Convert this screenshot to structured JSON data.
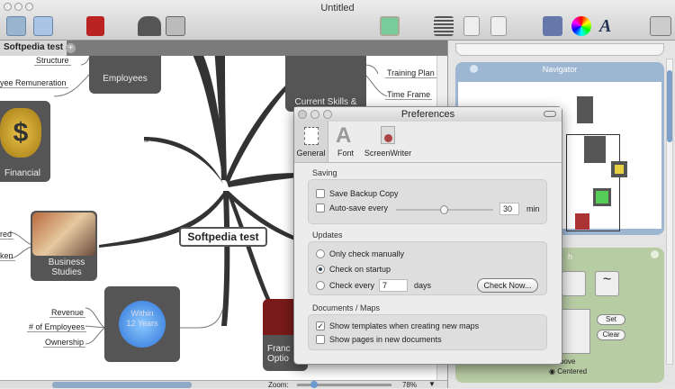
{
  "window": {
    "title": "Untitled"
  },
  "toolbar": {
    "icons": [
      "layout-icon",
      "layout-alt-icon",
      "book-icon",
      "people-icon",
      "contacts-icon",
      "image-icon",
      "align-icon",
      "export-icon",
      "export-alt-icon",
      "media-icon",
      "colors-icon",
      "fonts-icon",
      "print-icon"
    ]
  },
  "tabs": [
    {
      "label": "Softpedia test"
    }
  ],
  "map": {
    "center": "Softpedia test",
    "nodes": {
      "employees": "Employees",
      "financial": "Financial",
      "skills": "Current Skills &",
      "business": "Business Studies",
      "within": "Within 12 Years",
      "franc": "Franc Optio"
    },
    "leaves": {
      "structure": "Structure",
      "remuneration": "yee Remuneration",
      "training": "Training Plan",
      "timeframe": "Time Frame",
      "red": "red",
      "ken": "ken",
      "revenue": "Revenue",
      "employees_count": "# of Employees",
      "ownership": "Ownership"
    }
  },
  "bottom": {
    "zoom_label": "Zoom:",
    "zoom_value": "78%",
    "zoom_fraction": 0.2
  },
  "navigator": {
    "title": "Navigator"
  },
  "style_panel": {
    "title": "h",
    "set": "Set",
    "clear": "Clear",
    "above": "Above",
    "centered": "Centered"
  },
  "prefs": {
    "title": "Preferences",
    "tabs": [
      "General",
      "Font",
      "ScreenWriter"
    ],
    "saving": {
      "label": "Saving",
      "backup": "Save Backup Copy",
      "autosave": "Auto-save every",
      "minutes": "30",
      "unit": "min",
      "slider_fraction": 0.45
    },
    "updates": {
      "label": "Updates",
      "manual": "Only check manually",
      "startup": "Check on startup",
      "every": "Check every",
      "days_value": "7",
      "days": "days",
      "check_now": "Check Now..."
    },
    "docs": {
      "label": "Documents / Maps",
      "templates": "Show templates when creating new maps",
      "pages": "Show pages in new documents"
    }
  }
}
